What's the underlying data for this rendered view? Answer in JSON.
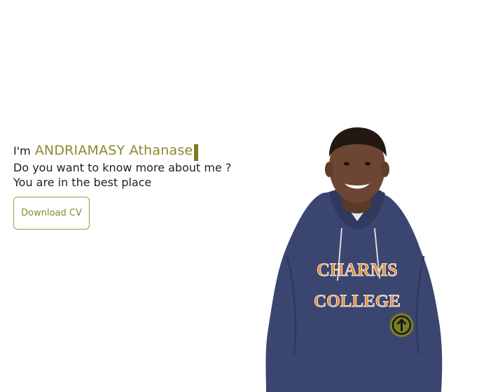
{
  "hero": {
    "greeting": "I'm",
    "name": "ANDRIAMASY Athanase",
    "question": "Do you want to know more about me ?",
    "tagline": "You are in the best place",
    "download_label": "Download CV"
  },
  "portrait": {
    "shirt_line1": "CHARMS",
    "shirt_line2": "COLLEGE"
  },
  "scroll_top": {
    "icon": "arrow-up-icon"
  },
  "colors": {
    "accent": "#8a8a2e",
    "caret": "#7c7c26",
    "scroll_button": "#7c7c26",
    "hoodie": "#3a466f"
  }
}
